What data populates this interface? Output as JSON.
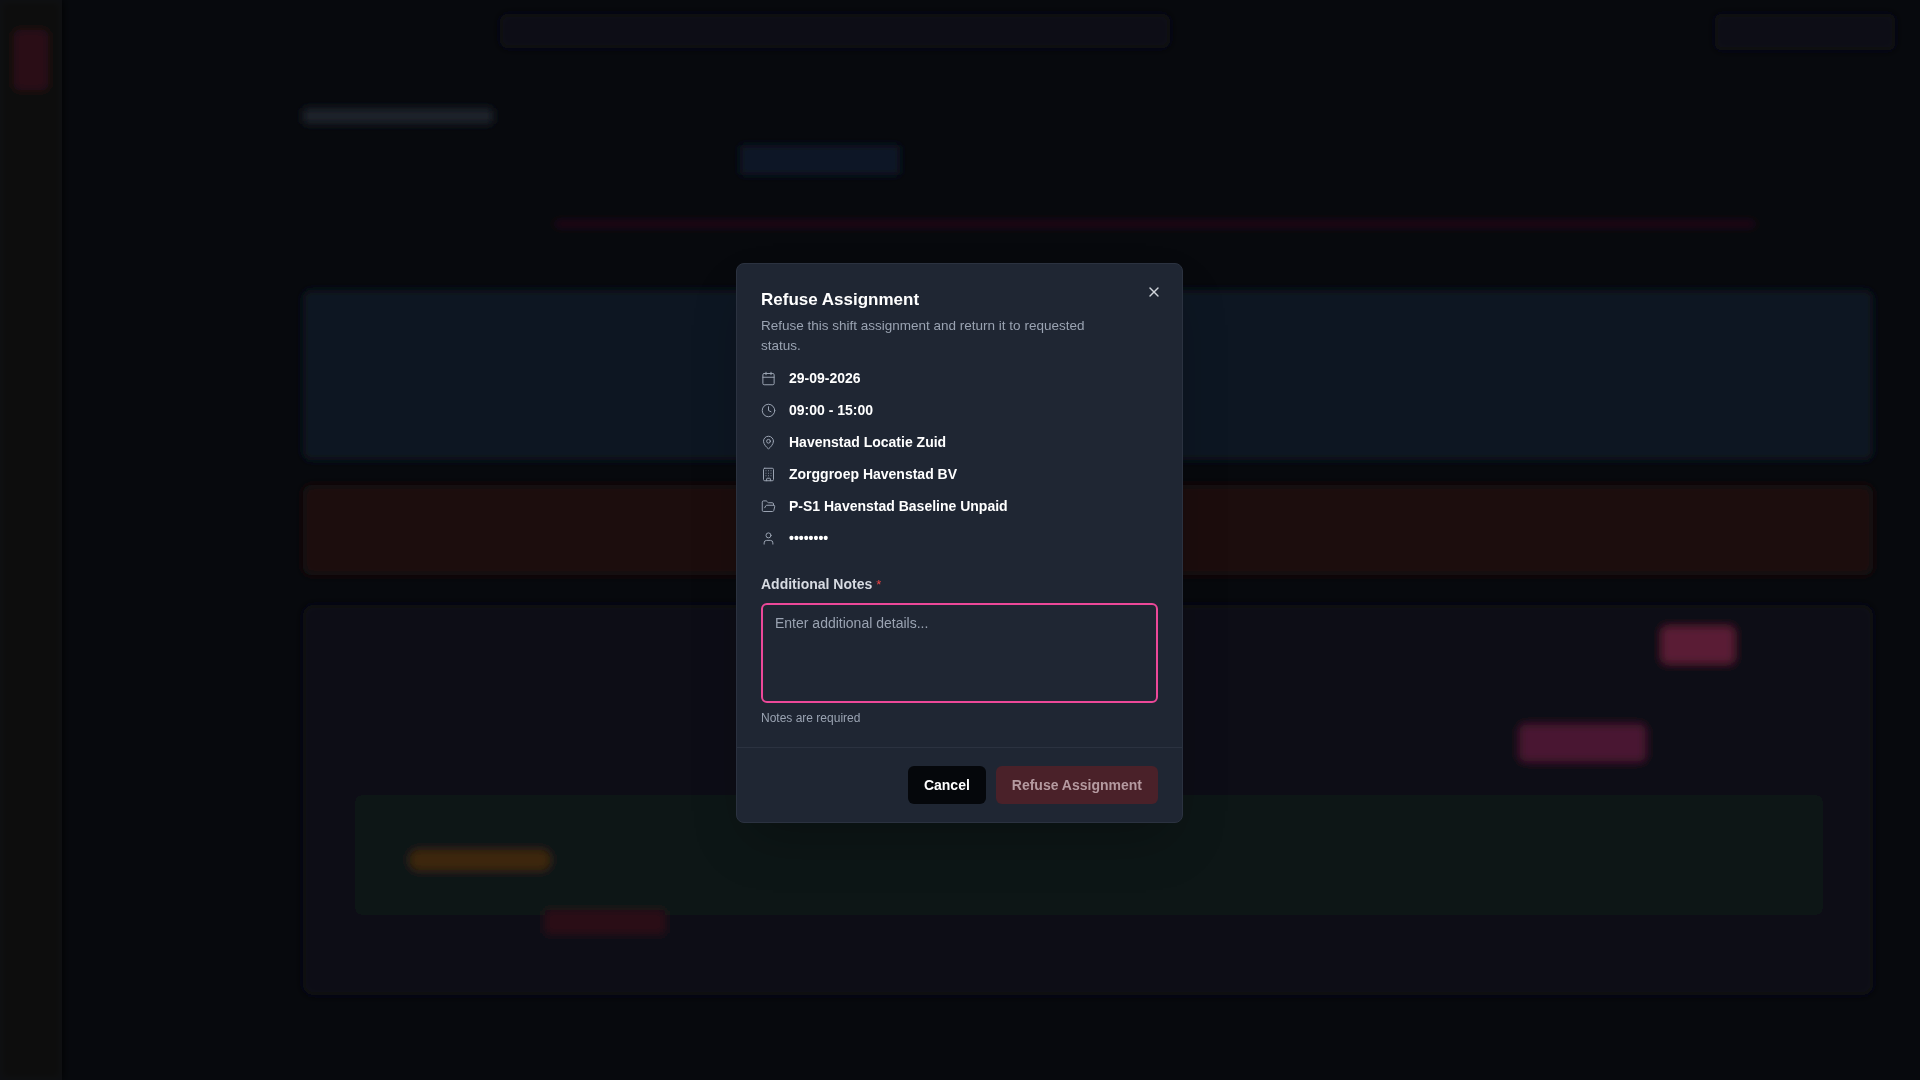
{
  "dialog": {
    "title": "Refuse Assignment",
    "description": "Refuse this shift assignment and return it to requested status.",
    "details": [
      {
        "kind": "date",
        "text": "29-09-2026"
      },
      {
        "kind": "time",
        "text": "09:00 - 15:00"
      },
      {
        "kind": "location",
        "text": "Havenstad Locatie Zuid"
      },
      {
        "kind": "organization",
        "text": "Zorggroep Havenstad BV"
      },
      {
        "kind": "project",
        "text": "P-S1 Havenstad Baseline Unpaid"
      },
      {
        "kind": "person",
        "text": "••••••••"
      }
    ],
    "notes": {
      "label": "Additional Notes",
      "required": true,
      "required_mark": "*",
      "placeholder": "Enter additional details...",
      "error": "Notes are required"
    },
    "buttons": [
      {
        "kind": "cancel",
        "label": "Cancel",
        "disabled": false
      },
      {
        "kind": "confirm",
        "label": "Refuse Assignment",
        "disabled": true
      }
    ]
  }
}
